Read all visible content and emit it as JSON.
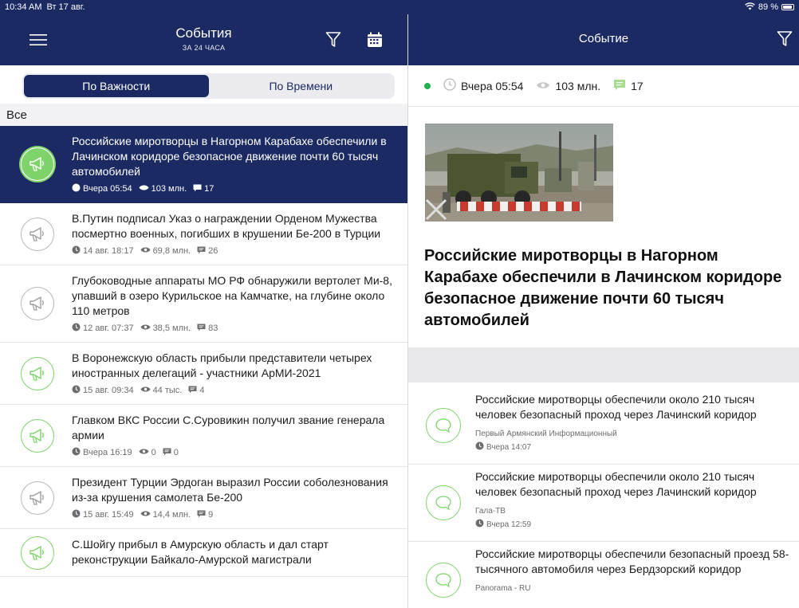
{
  "status_bar": {
    "time": "10:34 AM",
    "date": "Вт 17 авг.",
    "battery": "89 %"
  },
  "left": {
    "title": "События",
    "subtitle": "ЗА 24 ЧАСА",
    "segments": [
      "По Важности",
      "По Времени"
    ],
    "active_segment": 0,
    "section": "Все",
    "items": [
      {
        "title": "Российские миротворцы в Нагорном Карабахе обеспечили в Лачинском коридоре безопасное движение почти 60 тысяч автомобилей",
        "time": "Вчера 05:54",
        "views": "103 млн.",
        "comments": "17",
        "icon": "megaphone-icon",
        "green": true,
        "selected": true
      },
      {
        "title": "В.Путин подписал Указ о награждении Орденом Мужества посмертно военных, погибших в крушении Бе-200 в Турции",
        "time": "14 авг. 18:17",
        "views": "69,8 млн.",
        "comments": "26",
        "icon": "megaphone-icon",
        "green": false,
        "selected": false
      },
      {
        "title": "Глубоководные аппараты МО РФ обнаружили вертолет Ми-8, упавший в озеро Курильское на Камчатке, на глубине около 110 метров",
        "time": "12 авг. 07:37",
        "views": "38,5 млн.",
        "comments": "83",
        "icon": "megaphone-icon",
        "green": false,
        "selected": false
      },
      {
        "title": "В Воронежскую область прибыли представители четырех иностранных делегаций - участники АрМИ-2021",
        "time": "15 авг. 09:34",
        "views": "44 тыс.",
        "comments": "4",
        "icon": "megaphone-icon",
        "green": true,
        "selected": false
      },
      {
        "title": "Главком ВКС России С.Суровикин получил звание генерала армии",
        "time": "Вчера 16:19",
        "views": "0",
        "comments": "0",
        "icon": "megaphone-icon",
        "green": true,
        "selected": false
      },
      {
        "title": "Президент Турции Эрдоган выразил России соболезнования из-за крушения самолета Бе-200",
        "time": "15 авг. 15:49",
        "views": "14,4 млн.",
        "comments": "9",
        "icon": "megaphone-icon",
        "green": false,
        "selected": false
      },
      {
        "title": "С.Шойгу прибыл в Амурскую область и дал старт реконструкции Байкало-Амурской магистрали",
        "time": "",
        "views": "",
        "comments": "",
        "icon": "megaphone-icon",
        "green": true,
        "selected": false
      }
    ]
  },
  "right": {
    "title": "Событие",
    "meta": {
      "time": "Вчера 05:54",
      "views": "103 млн.",
      "comments": "17"
    },
    "headline": "Российские миротворцы в Нагорном Карабахе обеспечили в Лачинском коридоре безопасное движение почти 60 тысяч автомобилей",
    "related": [
      {
        "title": "Российские миротворцы обеспечили около 210 тысяч человек безопасный проход через Лачинский коридор",
        "source": "Первый Армянский Информационный",
        "time": "Вчера 14:07"
      },
      {
        "title": "Российские миротворцы обеспечили около 210 тысяч человек безопасный проход через Лачинский коридор",
        "source": "Гала-ТВ",
        "time": "Вчера 12:59"
      },
      {
        "title": "Российские миротворцы обеспечили безопасный проезд 58-тысячного автомобиля через Бердзорский коридор",
        "source": "Panorama - RU",
        "time": ""
      }
    ]
  },
  "colors": {
    "nav": "#1b2a63",
    "accent_green": "#7fd36b",
    "status_green": "#23b14d"
  }
}
